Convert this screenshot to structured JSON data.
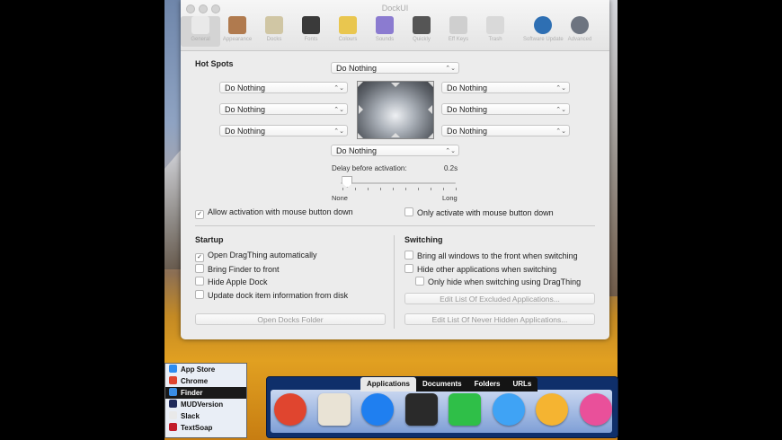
{
  "window": {
    "title": "DockUI",
    "toolbar": [
      {
        "label": "General",
        "icon": "general-icon",
        "color": "#e9e9e9"
      },
      {
        "label": "Appearance",
        "icon": "appearance-icon",
        "color": "#b07a4e"
      },
      {
        "label": "Docks",
        "icon": "docks-icon",
        "color": "#d0c6a4"
      },
      {
        "label": "Fonts",
        "icon": "fonts-icon",
        "color": "#3a3a3a"
      },
      {
        "label": "Colours",
        "icon": "colours-icon",
        "color": "#e9c64f"
      },
      {
        "label": "Sounds",
        "icon": "sounds-icon",
        "color": "#8b7bd0"
      },
      {
        "label": "Quickly",
        "icon": "quickly-icon",
        "color": "#555555"
      },
      {
        "label": "Eff Keys",
        "icon": "keys-icon",
        "color": "#cfcfcf"
      },
      {
        "label": "Trash",
        "icon": "trash-icon",
        "color": "#d9d9d9"
      },
      {
        "label": "Software Update",
        "icon": "update-icon",
        "color": "#2e6fb3"
      },
      {
        "label": "Advanced",
        "icon": "gear-icon",
        "color": "#6d7480"
      }
    ]
  },
  "hot_spots": {
    "heading": "Hot Spots",
    "top": "Do Nothing",
    "left": [
      "Do Nothing",
      "Do Nothing",
      "Do Nothing"
    ],
    "right": [
      "Do Nothing",
      "Do Nothing",
      "Do Nothing"
    ],
    "bottom": "Do Nothing",
    "delay_label": "Delay before activation:",
    "delay_value": "0.2s",
    "slider_min": "None",
    "slider_max": "Long",
    "slider_level": 0.05,
    "allow_mouse_down": "Allow activation with mouse button down",
    "allow_mouse_down_checked": true,
    "only_mouse_down": "Only activate with mouse button down",
    "only_mouse_down_checked": false
  },
  "startup": {
    "heading": "Startup",
    "options": [
      {
        "label": "Open DragThing automatically",
        "checked": true
      },
      {
        "label": "Bring Finder to front",
        "checked": false
      },
      {
        "label": "Hide Apple Dock",
        "checked": false
      },
      {
        "label": "Update dock item information from disk",
        "checked": false
      }
    ],
    "button": "Open Docks Folder"
  },
  "switching": {
    "heading": "Switching",
    "options": [
      {
        "label": "Bring all windows to the front when switching",
        "checked": false
      },
      {
        "label": "Hide other applications when switching",
        "checked": false
      },
      {
        "label": "Only hide when switching using DragThing",
        "checked": false
      }
    ],
    "button1": "Edit List Of Excluded Applications...",
    "button2": "Edit List Of Never Hidden Applications..."
  },
  "app_list": {
    "items": [
      {
        "label": "App Store",
        "color": "#2d8cf0"
      },
      {
        "label": "Chrome",
        "color": "#e0452f"
      },
      {
        "label": "Finder",
        "color": "#3a8ee6"
      },
      {
        "label": "MUDVersion",
        "color": "#1f2a5a"
      },
      {
        "label": "Slack",
        "color": "#e9e9e9"
      },
      {
        "label": "TextSoap",
        "color": "#c21d2b"
      }
    ],
    "selected": 2
  },
  "dock": {
    "tabs": [
      "Applications",
      "Documents",
      "Folders",
      "URLs"
    ],
    "selected_tab": 0,
    "icons": [
      {
        "name": "chrome-icon",
        "color": "#e0452f"
      },
      {
        "name": "scrivener-icon",
        "color": "#e9e3d5"
      },
      {
        "name": "app-store-icon",
        "color": "#1f7ff0"
      },
      {
        "name": "calculator-icon",
        "color": "#2a2a2a"
      },
      {
        "name": "facetime-icon",
        "color": "#2fbf48"
      },
      {
        "name": "messages-icon",
        "color": "#3fa3f5"
      },
      {
        "name": "photos-icon",
        "color": "#f5b431"
      },
      {
        "name": "itunes-icon",
        "color": "#e9509a"
      }
    ]
  }
}
